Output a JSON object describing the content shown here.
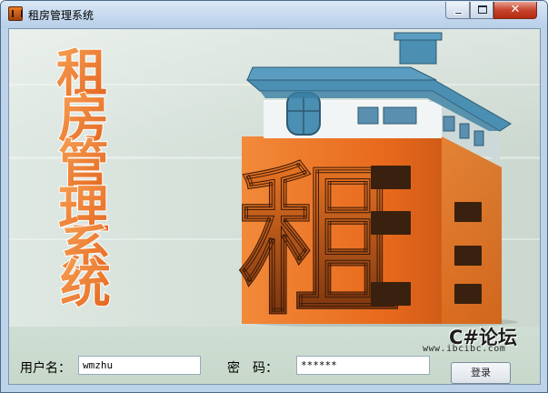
{
  "window": {
    "title": "租房管理系统",
    "title_icon": "app-rent-icon",
    "controls": {
      "minimize_icon": "minimize-icon",
      "maximize_icon": "maximize-icon",
      "close_glyph": "✕"
    }
  },
  "banner": {
    "vertical_title": [
      "租",
      "房",
      "管",
      "理",
      "系",
      "统"
    ],
    "house_character": "租",
    "colors": {
      "title_orange": "#ef7a2c",
      "building_orange": "#e8691c",
      "roof_blue": "#4b8fb3"
    }
  },
  "login": {
    "username_label": "用户名：",
    "username_value": "wmzhu",
    "password_label": "密　码：",
    "password_value": "******",
    "login_button": "登录"
  },
  "watermark": {
    "logo": "C#论坛",
    "url": "www.ibcibc.com"
  }
}
